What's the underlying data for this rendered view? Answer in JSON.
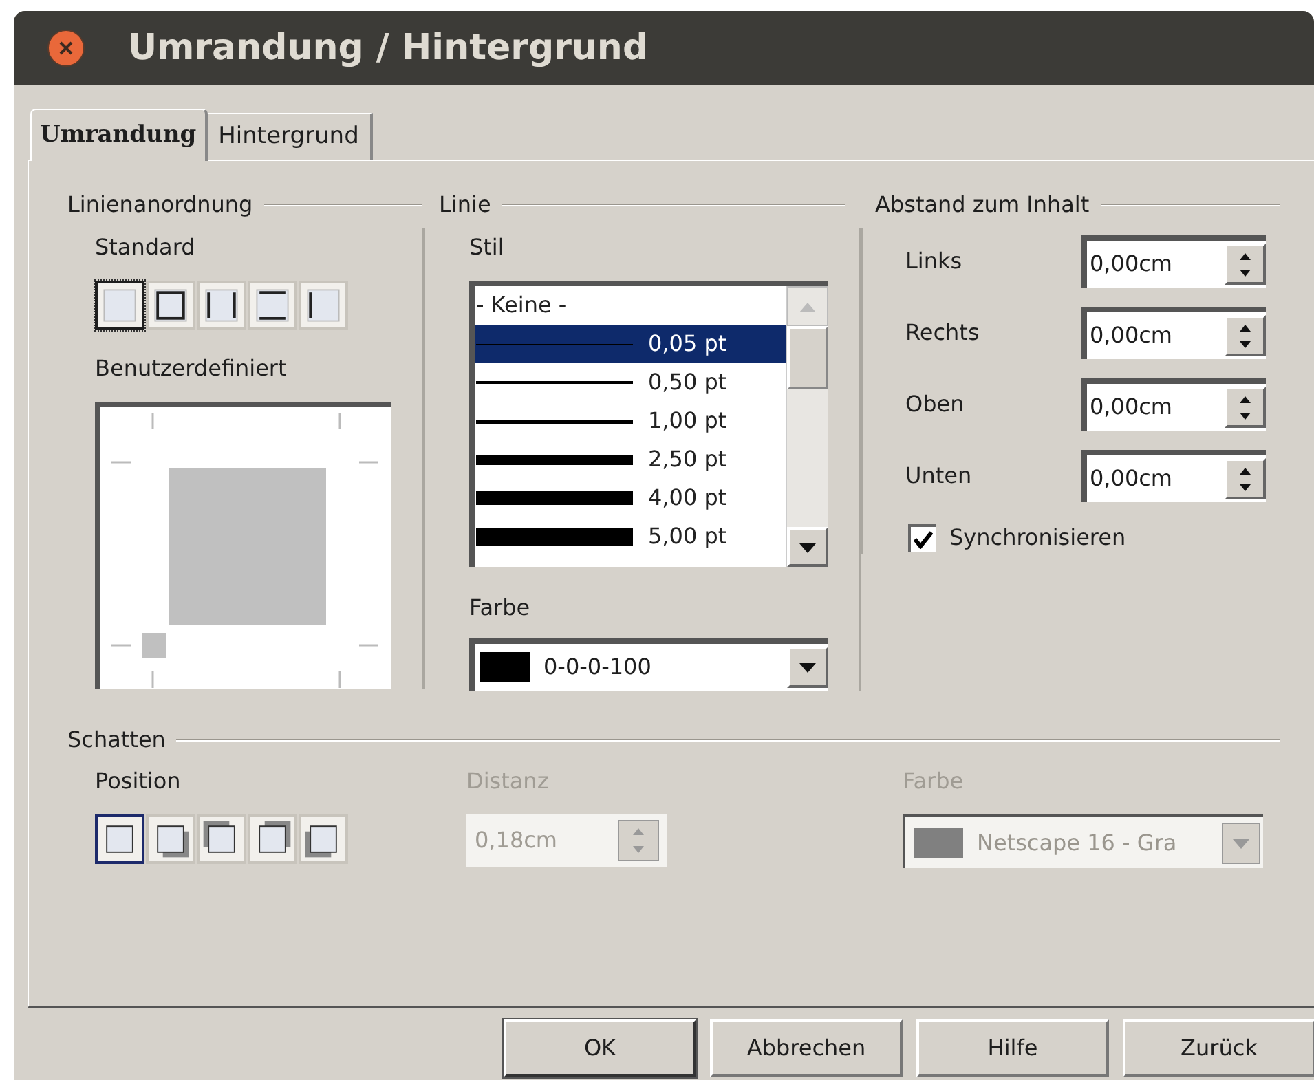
{
  "window": {
    "title": "Umrandung / Hintergrund"
  },
  "tabs": [
    {
      "label": "Umrandung",
      "selected": true
    },
    {
      "label": "Hintergrund",
      "selected": false
    }
  ],
  "line_arrangement": {
    "title": "Linienanordnung",
    "standard": {
      "label": "Standard",
      "presets": [
        {
          "selected": true
        },
        {
          "selected": false
        },
        {
          "selected": false
        },
        {
          "selected": false
        },
        {
          "selected": false
        }
      ]
    },
    "user_defined": {
      "label": "Benutzerdefiniert"
    }
  },
  "line": {
    "title": "Linie",
    "style": {
      "label": "Stil",
      "items": [
        {
          "label": "- Keine -",
          "kind": "none",
          "selected": false
        },
        {
          "label": "0,05 pt",
          "kind": "line",
          "selected": true
        },
        {
          "label": "0,50 pt",
          "kind": "line",
          "selected": false
        },
        {
          "label": "1,00 pt",
          "kind": "line",
          "selected": false
        },
        {
          "label": "2,50 pt",
          "kind": "line",
          "selected": false
        },
        {
          "label": "4,00 pt",
          "kind": "line",
          "selected": false
        },
        {
          "label": "5,00 pt",
          "kind": "line",
          "selected": false
        }
      ]
    },
    "color": {
      "label": "Farbe",
      "value": "0-0-0-100"
    }
  },
  "spacing": {
    "title": "Abstand zum Inhalt",
    "fields": [
      {
        "label": "Links",
        "value": "0,00cm"
      },
      {
        "label": "Rechts",
        "value": "0,00cm"
      },
      {
        "label": "Oben",
        "value": "0,00cm"
      },
      {
        "label": "Unten",
        "value": "0,00cm"
      }
    ],
    "synchronize": {
      "label": "Synchronisieren",
      "checked": true
    }
  },
  "shadow": {
    "title": "Schatten",
    "position": {
      "label": "Position",
      "presets": [
        {
          "selected": true
        },
        {
          "selected": false
        },
        {
          "selected": false
        },
        {
          "selected": false
        },
        {
          "selected": false
        }
      ]
    },
    "distance": {
      "label": "Distanz",
      "value": "0,18cm",
      "disabled": true
    },
    "color": {
      "label": "Farbe",
      "value": "Netscape 16 - Gra",
      "disabled": true
    }
  },
  "buttons": [
    {
      "label": "OK",
      "default": true
    },
    {
      "label": "Abbrechen",
      "default": false
    },
    {
      "label": "Hilfe",
      "default": false
    },
    {
      "label": "Zurück",
      "default": false
    }
  ]
}
